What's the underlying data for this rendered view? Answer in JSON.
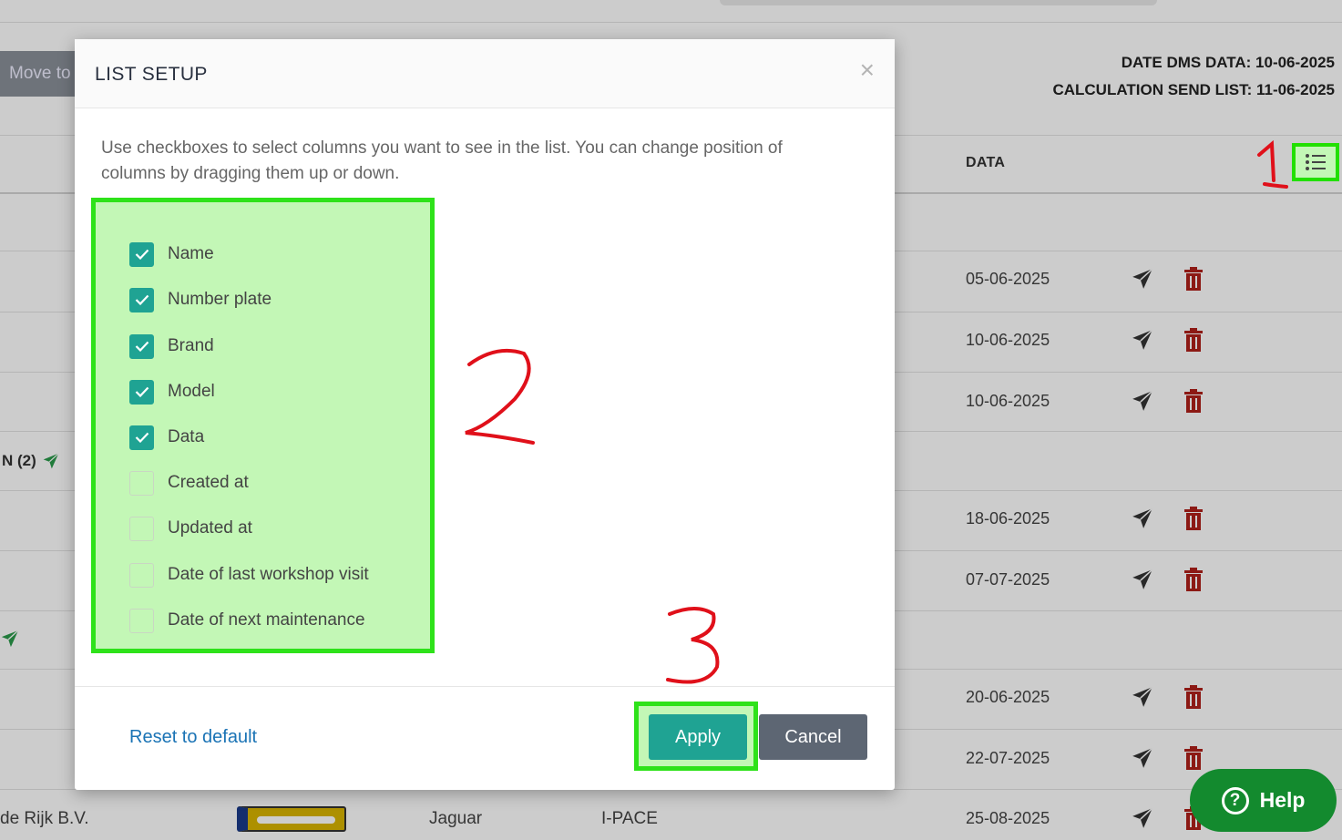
{
  "toolbar": {
    "move_label": "Move to"
  },
  "dms": {
    "date_dms_data": "DATE DMS DATA: 10-06-2025",
    "calculation_send_list": "CALCULATION SEND LIST: 11-06-2025"
  },
  "table": {
    "data_header": "DATA",
    "group_label": "N (2)",
    "rows": [
      {
        "date": "05-06-2025"
      },
      {
        "date": "10-06-2025"
      },
      {
        "date": "10-06-2025"
      },
      {
        "date": "18-06-2025"
      },
      {
        "date": "07-07-2025"
      },
      {
        "date": "20-06-2025"
      },
      {
        "date": "22-07-2025"
      },
      {
        "date": "25-08-2025",
        "name": "de Rijk B.V.",
        "brand": "Jaguar",
        "model": "I-PACE"
      }
    ]
  },
  "modal": {
    "title": "LIST SETUP",
    "close": "×",
    "description": "Use checkboxes to select columns you want to see in the list. You can change position of columns by dragging them up or down.",
    "columns": [
      {
        "label": "Name",
        "checked": true
      },
      {
        "label": "Number plate",
        "checked": true
      },
      {
        "label": "Brand",
        "checked": true
      },
      {
        "label": "Model",
        "checked": true
      },
      {
        "label": "Data",
        "checked": true
      },
      {
        "label": "Created at",
        "checked": false
      },
      {
        "label": "Updated at",
        "checked": false
      },
      {
        "label": "Date of last workshop visit",
        "checked": false
      },
      {
        "label": "Date of next maintenance",
        "checked": false
      }
    ],
    "reset_label": "Reset to default",
    "apply_label": "Apply",
    "cancel_label": "Cancel"
  },
  "annotations": {
    "one": "1",
    "two": "2",
    "three": "3"
  },
  "help": {
    "label": "Help"
  },
  "icons": {
    "list_setup": "list-icon",
    "send": "paper-plane-icon",
    "delete": "trash-icon",
    "help": "question-circle-icon",
    "check": "check-icon"
  },
  "colors": {
    "teal": "#1fa393",
    "highlight_border": "#2ee21a",
    "highlight_fill": "#c3f7b6",
    "annotation_red": "#e0101a",
    "help_green": "#138a2e",
    "trash_red": "#b0201a",
    "send_green": "#2a9a4a"
  }
}
